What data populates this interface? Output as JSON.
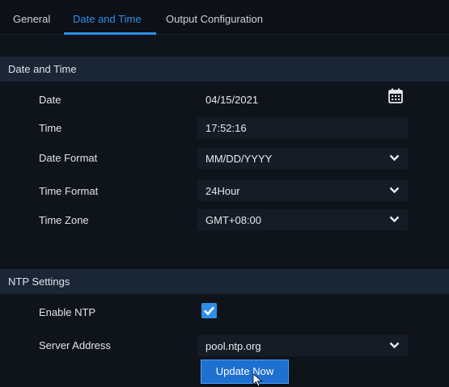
{
  "tabs": {
    "general": "General",
    "date_and_time": "Date and Time",
    "output_configuration": "Output Configuration"
  },
  "date_and_time": {
    "section_title": "Date and Time",
    "date_label": "Date",
    "date_value": "04/15/2021",
    "time_label": "Time",
    "time_value": "17:52:16",
    "date_format_label": "Date Format",
    "date_format_value": "MM/DD/YYYY",
    "time_format_label": "Time Format",
    "time_format_value": "24Hour",
    "time_zone_label": "Time Zone",
    "time_zone_value": "GMT+08:00"
  },
  "ntp": {
    "section_title": "NTP Settings",
    "enable_label": "Enable NTP",
    "enabled": true,
    "server_label": "Server Address",
    "server_value": "pool.ntp.org",
    "update_button": "Update Now"
  },
  "colors": {
    "accent": "#2f8fe8",
    "background": "#0f131a",
    "section": "#1a2535"
  },
  "icons": {
    "calendar": "calendar-icon",
    "dropdown": "chevron-down-icon",
    "check": "checkmark-icon",
    "cursor": "mouse-cursor-icon"
  }
}
